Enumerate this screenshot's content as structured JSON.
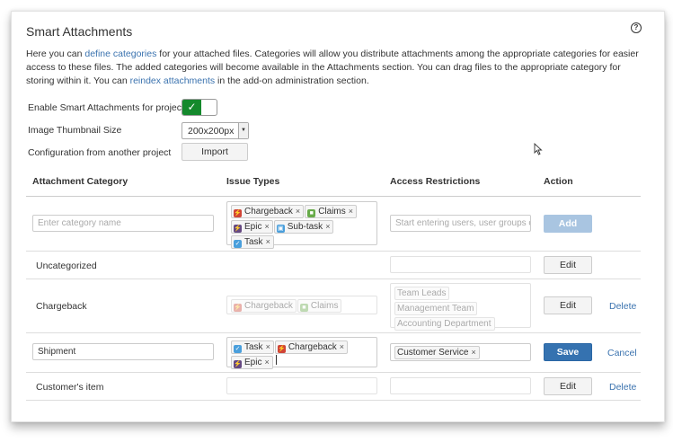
{
  "title": "Smart Attachments",
  "help_glyph": "?",
  "description": {
    "part1": "Here you can ",
    "link1": "define categories",
    "part2": " for your attached files. Categories will allow you distribute attachments among the appropriate categories for easier access to these files. The added categories will become available in the Attachments section. You can drag files to the appropriate category for storing within it. You can ",
    "link2": "reindex attachments",
    "part3": " in the add-on administration section."
  },
  "settings": {
    "enable_label": "Enable Smart Attachments for project",
    "enable_check": "✓",
    "thumb_label": "Image Thumbnail Size",
    "thumb_value": "200x200px",
    "config_label": "Configuration from another project",
    "import_label": "Import"
  },
  "table": {
    "headers": {
      "category": "Attachment Category",
      "issue_types": "Issue Types",
      "access": "Access Restrictions",
      "action": "Action"
    },
    "new_row": {
      "category_placeholder": "Enter category name",
      "issue_types": [
        "Chargeback",
        "Claims",
        "Epic",
        "Sub-task",
        "Task"
      ],
      "access_placeholder": "Start entering users, user groups o",
      "add_label": "Add"
    },
    "rows": [
      {
        "category": "Uncategorized",
        "edit": "Edit"
      },
      {
        "category": "Chargeback",
        "issue_types": [
          "Chargeback",
          "Claims"
        ],
        "access": [
          "Team Leads",
          "Management Team",
          "Accounting Department"
        ],
        "edit": "Edit",
        "delete": "Delete"
      },
      {
        "category": "Shipment",
        "issue_types": [
          "Task",
          "Chargeback",
          "Epic"
        ],
        "access": [
          "Customer Service"
        ],
        "save": "Save",
        "cancel": "Cancel"
      },
      {
        "category": "Customer's item",
        "edit": "Edit",
        "delete": "Delete"
      }
    ],
    "remove_glyph": "×"
  },
  "colors": {
    "accent": "#3572b0",
    "toggle_on": "#14892c",
    "link": "#3b73af",
    "chargeback": "#d04437",
    "claims": "#67ab49",
    "epic": "#654982",
    "task": "#4a9fdc"
  },
  "icons": {
    "chargeback": "chargeback-icon",
    "claims": "claims-icon",
    "epic": "epic-icon",
    "subtask": "subtask-icon",
    "task": "task-icon",
    "help": "help-icon",
    "cursor": "mouse-cursor-icon"
  }
}
